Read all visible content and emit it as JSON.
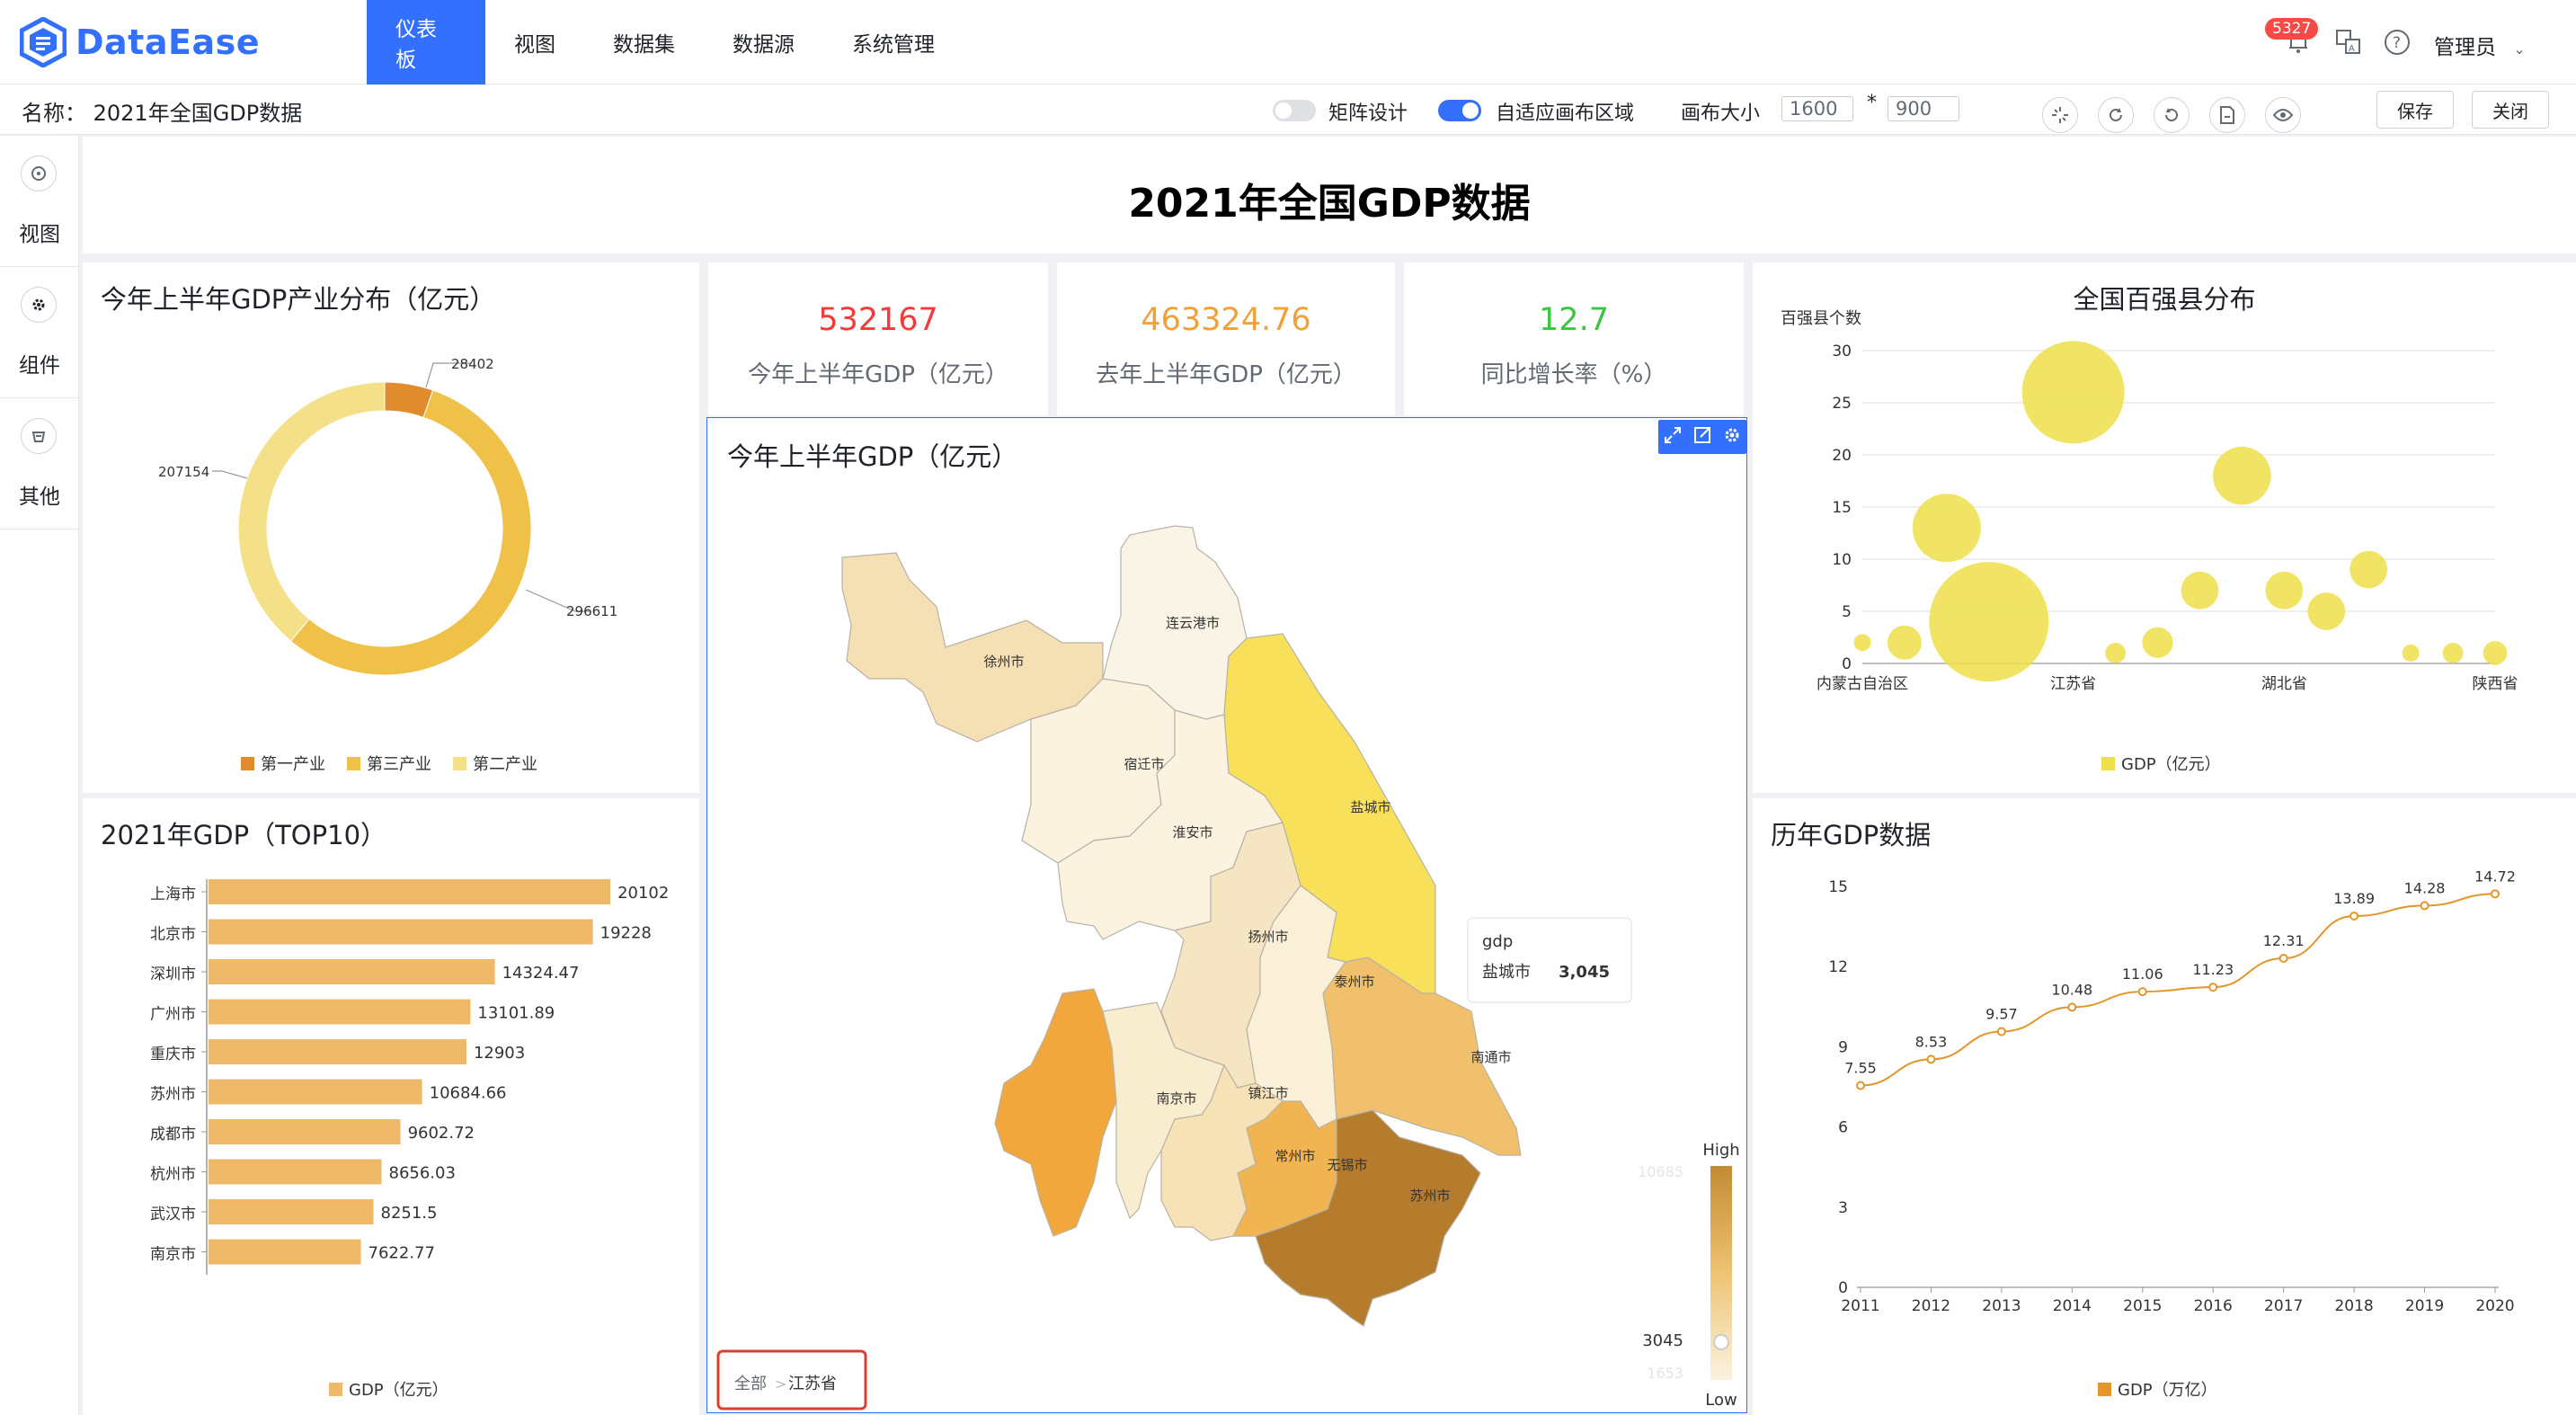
{
  "app": {
    "logo_text": "DataEase",
    "nav": [
      "仪表板",
      "视图",
      "数据集",
      "数据源",
      "系统管理"
    ],
    "badge": "5327",
    "user": "管理员"
  },
  "subbar": {
    "name": "名称： 2021年全国GDP数据",
    "matrix_label": "矩阵设计",
    "adaptive_label": "自适应画布区域",
    "canvas_size_label": "画布大小",
    "width": "1600",
    "times": "*",
    "height": "900",
    "save": "保存",
    "close": "关闭"
  },
  "rail": [
    "视图",
    "组件",
    "其他"
  ],
  "dashboard": {
    "title": "2021年全国GDP数据",
    "kpis": [
      {
        "value": "532167",
        "label": "今年上半年GDP（亿元）",
        "color": "#f23c3c"
      },
      {
        "value": "463324.76",
        "label": "去年上半年GDP（亿元）",
        "color": "#f2a03a"
      },
      {
        "value": "12.7",
        "label": "同比增长率（%）",
        "color": "#3ec443"
      }
    ]
  },
  "charts": {
    "donut": {
      "title": "今年上半年GDP产业分布（亿元）",
      "slice_labels": [
        "28402",
        "296611",
        "207154"
      ],
      "legend": [
        "第一产业",
        "第三产业",
        "第二产业"
      ]
    },
    "bar": {
      "title": "2021年GDP（TOP10）",
      "legend": "GDP（亿元）"
    },
    "map": {
      "title": "今年上半年GDP（亿元）",
      "cities": [
        "连云港市",
        "徐州市",
        "宿迁市",
        "盐城市",
        "淮安市",
        "扬州市",
        "泰州市",
        "南通市",
        "南京市",
        "镇江市",
        "常州市",
        "无锡市",
        "苏州市"
      ],
      "tooltip_title": "gdp",
      "tooltip_city": "盐城市",
      "tooltip_value": "3,045",
      "visualmap_high": "High",
      "visualmap_low": "Low",
      "visualmap_max": "10685",
      "visualmap_cur": "3045",
      "visualmap_min": "1653",
      "breadcrumb_all": "全部",
      "breadcrumb_sep": ">",
      "breadcrumb_province": "江苏省"
    },
    "bubble": {
      "title": "全国百强县分布",
      "legend": "GDP（亿元）"
    },
    "line": {
      "title": "历年GDP数据",
      "legend": "GDP（万亿）"
    }
  },
  "chart_data": [
    {
      "type": "pie",
      "categories": [
        "第一产业",
        "第三产业",
        "第二产业"
      ],
      "values": [
        28402,
        296611,
        207154
      ],
      "colors": [
        "#e08c2e",
        "#efc148",
        "#f5e08a"
      ]
    },
    {
      "type": "bar",
      "categories": [
        "上海市",
        "北京市",
        "深圳市",
        "广州市",
        "重庆市",
        "苏州市",
        "成都市",
        "杭州市",
        "武汉市",
        "南京市"
      ],
      "values": [
        20102,
        19228,
        14324.47,
        13101.89,
        12903,
        10684.66,
        9602.72,
        8656.03,
        8251.5,
        7622.77
      ],
      "value_labels": [
        "20102",
        "19228",
        "14324.47",
        "13101.89",
        "12903",
        "10684.66",
        "9602.72",
        "8656.03",
        "8251.5",
        "7622.77"
      ],
      "color": "#efb96a"
    },
    {
      "type": "scatter",
      "ylabel": "百强县个数",
      "ylim": [
        0,
        30
      ],
      "yticks": [
        0,
        5,
        10,
        15,
        20,
        25,
        30
      ],
      "xticks": [
        "内蒙古自治区",
        "江苏省",
        "湖北省",
        "陕西省"
      ],
      "points": [
        {
          "xi": 0,
          "y": 2,
          "size": 1
        },
        {
          "xi": 1,
          "y": 2,
          "size": 2
        },
        {
          "xi": 2,
          "y": 13,
          "size": 4
        },
        {
          "xi": 3,
          "y": 4,
          "size": 7
        },
        {
          "xi": 5,
          "y": 26,
          "size": 6
        },
        {
          "xi": 6,
          "y": 1,
          "size": 1.2
        },
        {
          "xi": 7,
          "y": 2,
          "size": 1.8
        },
        {
          "xi": 8,
          "y": 7,
          "size": 2.2
        },
        {
          "xi": 9,
          "y": 18,
          "size": 3.4
        },
        {
          "xi": 10,
          "y": 7,
          "size": 2.2
        },
        {
          "xi": 11,
          "y": 5,
          "size": 2.2
        },
        {
          "xi": 12,
          "y": 9,
          "size": 2.2
        },
        {
          "xi": 13,
          "y": 1,
          "size": 1
        },
        {
          "xi": 14,
          "y": 1,
          "size": 1.2
        },
        {
          "xi": 15,
          "y": 1,
          "size": 1.4
        }
      ],
      "x_count": 16,
      "color": "#efdf4a"
    },
    {
      "type": "line",
      "x": [
        "2011",
        "2012",
        "2013",
        "2014",
        "2015",
        "2016",
        "2017",
        "2018",
        "2019",
        "2020"
      ],
      "values": [
        7.55,
        8.53,
        9.57,
        10.48,
        11.06,
        11.23,
        12.31,
        13.89,
        14.28,
        14.72
      ],
      "ylim": [
        0,
        15
      ],
      "yticks": [
        0,
        3,
        6,
        9,
        12,
        15
      ],
      "color": "#e2962b"
    }
  ]
}
